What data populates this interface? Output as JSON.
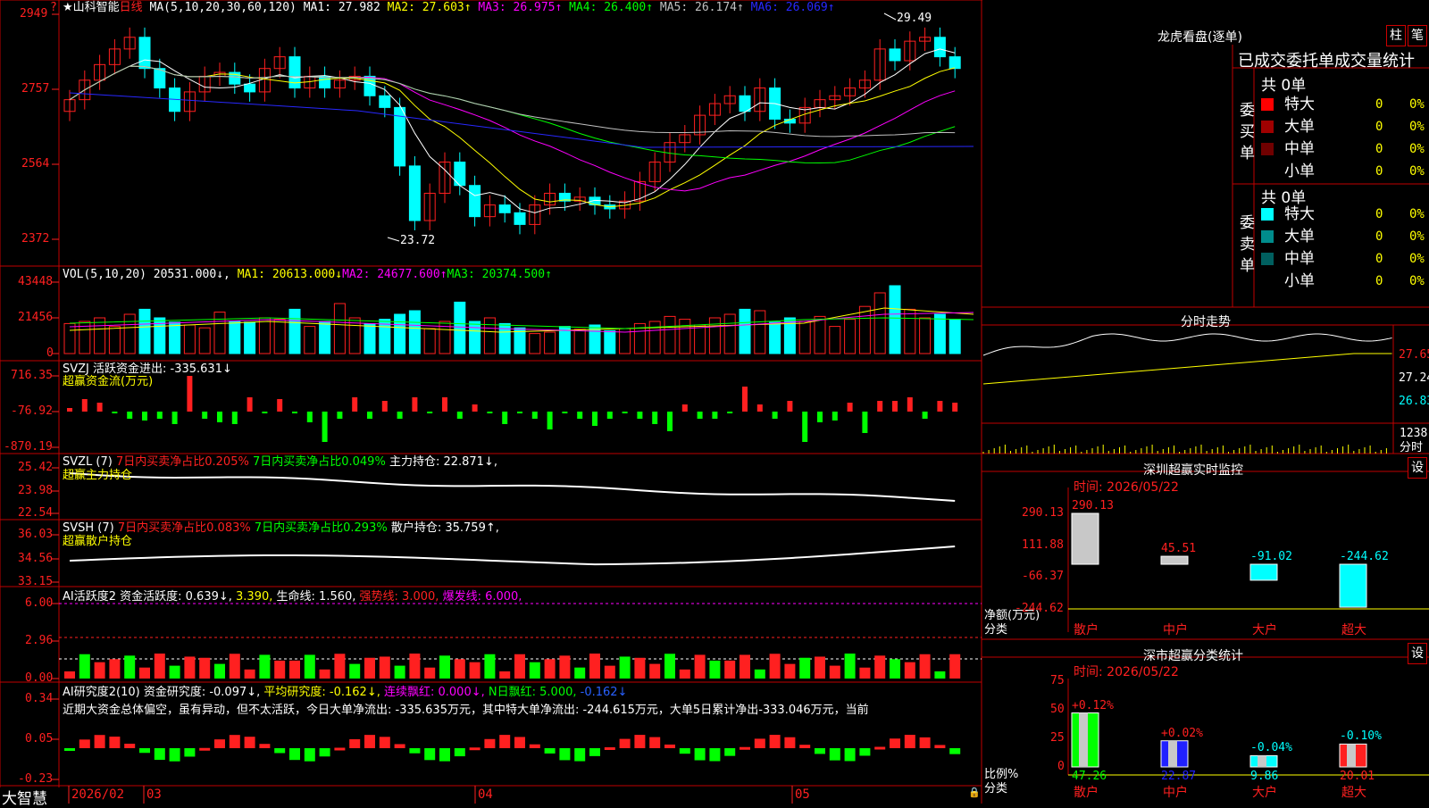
{
  "app": {
    "brand": "大智慧",
    "stock": "★山科智能",
    "period": "日线"
  },
  "colors": {
    "up": "#ff2020",
    "down": "#00ffff",
    "border": "#c00000",
    "ma_white": "#ffffff",
    "ma_yellow": "#ffff00",
    "ma_magenta": "#ff00ff",
    "ma_green": "#00ff00",
    "ma_grey": "#c0c0c0",
    "ma_blue": "#2828ff"
  },
  "price_panel": {
    "ma_label": "MA(5,10,20,30,60,120)",
    "ma_values": [
      {
        "name": "MA1:",
        "value": "27.982",
        "arrow": "",
        "color": "#ffffff"
      },
      {
        "name": "MA2:",
        "value": "27.603",
        "arrow": "↑",
        "color": "#ffff00"
      },
      {
        "name": "MA3:",
        "value": "26.975",
        "arrow": "↑",
        "color": "#ff00ff"
      },
      {
        "name": "MA4:",
        "value": "26.400",
        "arrow": "↑",
        "color": "#00ff00"
      },
      {
        "name": "MA5:",
        "value": "26.174",
        "arrow": "↑",
        "color": "#c0c0c0"
      },
      {
        "name": "MA6:",
        "value": "26.069",
        "arrow": "↑",
        "color": "#2828ff"
      }
    ],
    "y_labels": [
      "2949",
      "2757",
      "2564",
      "2372"
    ],
    "max_label": "29.49",
    "min_label": "23.72"
  },
  "vol_panel": {
    "title": "VOL(5,10,20)",
    "value": "20531.000↓",
    "mas": [
      {
        "text": "MA1: 20613.000↓",
        "color": "#ffff00"
      },
      {
        "text": "MA2: 24677.600↑",
        "color": "#ff00ff"
      },
      {
        "text": "MA3: 20374.500↑",
        "color": "#00ff00"
      }
    ],
    "y_labels": [
      "43448",
      "21456",
      "0"
    ]
  },
  "svzj_panel": {
    "title": "SVZJ 活跃资金进出: -335.631↓",
    "subtitle": "超赢资金流(万元)",
    "y_labels": [
      "716.35",
      "-76.92",
      "-870.19"
    ]
  },
  "svzl_panel": {
    "name": "SVZL (7)",
    "p1": "7日内买卖净占比0.205%",
    "p2": "7日内买卖净占比0.049%",
    "p3": "主力持仓: 22.871↓,",
    "subtitle": "超赢主力持仓",
    "y_labels": [
      "25.42",
      "23.98",
      "22.54"
    ]
  },
  "svsh_panel": {
    "name": "SVSH (7)",
    "p1": "7日内买卖净占比0.083%",
    "p2": "7日内买卖净占比0.293%",
    "p3": "散户持仓: 35.759↑,",
    "subtitle": "超赢散户持仓",
    "y_labels": [
      "36.03",
      "34.56",
      "33.15"
    ]
  },
  "ai_active_panel": {
    "t1": "AI活跃度2 资金活跃度: 0.639↓,",
    "t2": "3.390,",
    "t3": "生命线: 1.560,",
    "t4": "强势线: 3.000,",
    "t5": "爆发线: 6.000,",
    "y_labels": [
      "6.00",
      "2.96",
      "0.00"
    ]
  },
  "ai_research_panel": {
    "t1": "AI研究度2(10) 资金研究度: -0.097↓,",
    "t2": "平均研究度: -0.162↓,",
    "t3": "连续飘红: 0.000↓,",
    "t4": "N日飘红: 5.000,",
    "t5": "-0.162↓",
    "comment": "近期大资金总体偏空，虽有异动，但不太活跃，今日大单净流出: -335.635万元，其中特大单净流出: -244.615万元，大单5日累计净出-333.046万元，当前",
    "y_labels": [
      "0.34",
      "0.05",
      "-0.23"
    ]
  },
  "date_axis": {
    "labels": [
      "2026/02",
      "03",
      "04",
      "05"
    ]
  },
  "dragon": {
    "title": "龙虎看盘(逐单)",
    "btn_zhu": "柱",
    "btn_bi": "笔",
    "tabs": "已成交委托单成交量统计",
    "buy_label": "委买单",
    "sell_label": "委卖单",
    "buy_total": "共 0单",
    "sell_total": "共 0单",
    "buy_rows": [
      {
        "name": "特大",
        "count": "0",
        "pct": "0%",
        "color": "#ff0000"
      },
      {
        "name": "大单",
        "count": "0",
        "pct": "0%",
        "color": "#a00000"
      },
      {
        "name": "中单",
        "count": "0",
        "pct": "0%",
        "color": "#700000"
      },
      {
        "name": "小单",
        "count": "0",
        "pct": "0%",
        "color": ""
      }
    ],
    "sell_rows": [
      {
        "name": "特大",
        "count": "0",
        "pct": "0%",
        "color": "#00ffff"
      },
      {
        "name": "大单",
        "count": "0",
        "pct": "0%",
        "color": "#008c8c"
      },
      {
        "name": "中单",
        "count": "0",
        "pct": "0%",
        "color": "#005f5f"
      },
      {
        "name": "小单",
        "count": "0",
        "pct": "0%",
        "color": ""
      }
    ]
  },
  "intraday": {
    "title": "分时走势",
    "y_labels": [
      "27.65",
      "27.24",
      "26.83"
    ],
    "vol_label": "1238",
    "tag": "分时"
  },
  "sz_monitor": {
    "title": "深圳超赢实时监控",
    "btn": "设",
    "time": "时间: 2026/05/22",
    "y_labels": [
      "290.13",
      "111.88",
      "-66.37",
      "-244.62"
    ],
    "y_title": "净额(万元)",
    "x_title": "分类",
    "chart_data": {
      "type": "bar",
      "categories": [
        "散户",
        "中户",
        "大户",
        "超大"
      ],
      "values": [
        290.13,
        45.51,
        -91.02,
        -244.62
      ],
      "ylim": [
        -244.62,
        290.13
      ]
    },
    "value_labels": [
      "290.13",
      "45.51",
      "-91.02",
      "-244.62"
    ]
  },
  "sz_class": {
    "title": "深市超赢分类统计",
    "btn": "设",
    "time": "时间: 2026/05/22",
    "y_labels": [
      "75",
      "50",
      "25",
      "0"
    ],
    "y_title": "比例%",
    "x_title": "分类",
    "chart_data": {
      "type": "bar",
      "categories": [
        "散户",
        "中户",
        "大户",
        "超大"
      ],
      "values": [
        47.26,
        22.87,
        9.86,
        20.01
      ],
      "changes": [
        "+0.12%",
        "+0.02%",
        "-0.04%",
        "-0.10%"
      ],
      "ylim": [
        0,
        75
      ]
    }
  }
}
